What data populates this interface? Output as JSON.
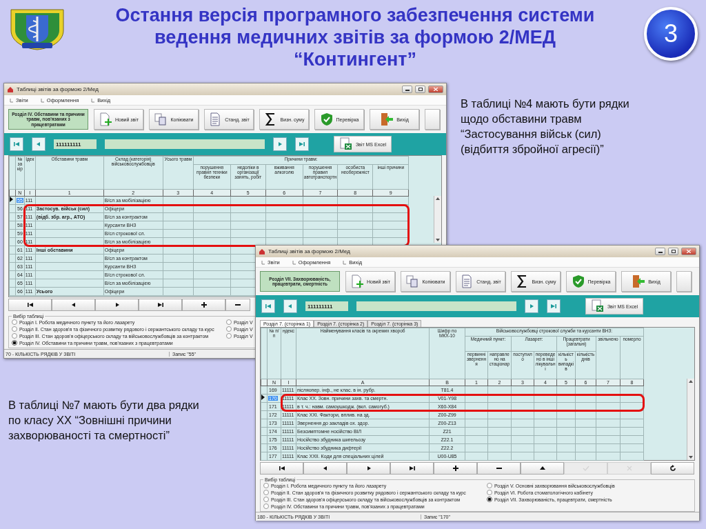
{
  "slide": {
    "title": "Остання версія програмного забезпечення системи ведення медичних звітів за формою 2/МЕД “Контингент”",
    "page_number": "3"
  },
  "notes": [
    {
      "text": "В таблиці №4 мають бути рядки\nщодо обставини травм\n“Застосування військ (сил)\n(відбиття збройної агресії)”"
    },
    {
      "text": "В таблиці №7 мають бути два рядки\nпо класу XX “Зовнішні причини\nзахворюваності та смертності”"
    }
  ],
  "windows": [
    {
      "title": "Таблиці звітів за формою 2/Мед",
      "menu": [
        "Звіти",
        "Оформлення",
        "Вихід"
      ],
      "section": "Розділ IV. Обставини та причини травм, пов'язаних з працевтратами",
      "toolbar": [
        {
          "kind": "new",
          "label": "Новий звіт"
        },
        {
          "kind": "copy",
          "label": "Копіювати"
        },
        {
          "kind": "report",
          "label": "Станд. звіт"
        },
        {
          "kind": "sum",
          "label": "Визн. суму"
        },
        {
          "kind": "check",
          "label": "Перевірка"
        },
        {
          "kind": "exit",
          "label": "Вихід"
        },
        {
          "kind": "blank"
        }
      ],
      "navigator": {
        "buttons": [
          {
            "kind": "first"
          },
          {
            "kind": "prev"
          },
          {
            "kind": "next"
          },
          {
            "kind": "last"
          }
        ],
        "code": "111111111",
        "excel_button": "Звіт MS Excel"
      },
      "table": {
        "kind": "injuries",
        "columns": [
          {
            "label": "№ за кір"
          },
          {
            "label": "Ідек"
          },
          {
            "label": "Обставини травм"
          },
          {
            "label": "Склад (категорія) військовослужбовців"
          },
          {
            "label": "Усього травм"
          },
          {
            "label": "Причини травм:",
            "children": [
              {
                "label": "порушення правил техніки безпеки"
              },
              {
                "label": "недоліки в організації занять, робіт"
              },
              {
                "label": "вживання алкоголю"
              },
              {
                "label": "порушення правил автотранспортн"
              },
              {
                "label": "особиста необережніст"
              },
              {
                "label": "інші причини"
              }
            ]
          }
        ],
        "numbers": [
          "N",
          "I",
          "1",
          "2",
          "3",
          "4",
          "5",
          "6",
          "7",
          "8",
          "9"
        ],
        "rows": [
          {
            "number": "55",
            "index": "111",
            "personnel": "В/сл за мобілізацією",
            "selected": true,
            "highlighted": false
          },
          {
            "number": "56",
            "index": "111",
            "circumstance": "Застосув. військ (сил)",
            "personnel": "Офіцери",
            "selected": false,
            "highlighted": true,
            "heading": true
          },
          {
            "number": "57",
            "index": "111",
            "circumstance": "(відб. збр. агр., АТО)",
            "personnel": "В/сл за контрактом",
            "selected": false,
            "highlighted": true,
            "heading": true
          },
          {
            "number": "58",
            "index": "111",
            "personnel": "Курсанти ВНЗ",
            "selected": false,
            "highlighted": true
          },
          {
            "number": "59",
            "index": "111",
            "personnel": "В/сл строкової сл.",
            "selected": false,
            "highlighted": true
          },
          {
            "number": "60",
            "index": "111",
            "personnel": "В/сл за мобілізацією",
            "selected": false,
            "highlighted": true
          },
          {
            "number": "61",
            "index": "111",
            "circumstance": "Інші обставини",
            "personnel": "Офіцери",
            "selected": false,
            "highlighted": false,
            "heading": true
          },
          {
            "number": "62",
            "index": "111",
            "personnel": "В/сл за контрактом",
            "selected": false,
            "highlighted": false
          },
          {
            "number": "63",
            "index": "111",
            "personnel": "Курсанти ВНЗ",
            "selected": false,
            "highlighted": false
          },
          {
            "number": "64",
            "index": "111",
            "personnel": "В/сл строкової сл.",
            "selected": false,
            "highlighted": false
          },
          {
            "number": "65",
            "index": "111",
            "personnel": "В/сл за мобілізацією",
            "selected": false,
            "highlighted": false
          },
          {
            "number": "66",
            "index": "111",
            "circumstance": "Усього",
            "personnel": "Офіцери",
            "selected": false,
            "highlighted": false,
            "heading": true
          }
        ]
      },
      "nav_buttons": [
        {
          "kind": "first",
          "disabled": false
        },
        {
          "kind": "prev",
          "disabled": false
        },
        {
          "kind": "next",
          "disabled": false
        },
        {
          "kind": "last",
          "disabled": false
        },
        {
          "kind": "add",
          "disabled": false
        },
        {
          "kind": "remove",
          "disabled": false
        }
      ],
      "table_choice": {
        "label": "Вибір таблиці",
        "options": [
          {
            "label": "Розділ I. Робота медичного пункту та його лазарету",
            "selected": false
          },
          {
            "label": "Розділ II. Стан здоров'я та фізичного розвитку рядового і сержантського складу та курс",
            "selected": false
          },
          {
            "label": "Розділ III. Стан здоров'я офіцерського складу та військовослужбовців за контрактом",
            "selected": false
          },
          {
            "label": "Розділ IV. Обставини та причини травм, пов'язаних з працевтратами",
            "selected": true
          },
          {
            "label": "Розділ V",
            "selected": false
          },
          {
            "label": "Розділ V",
            "selected": false
          },
          {
            "label": "Розділ V",
            "selected": false
          }
        ]
      },
      "status": {
        "count": "70 - КІЛЬКІСТЬ РЯДКІВ У ЗВІТІ",
        "record": "Запис \"55\""
      }
    },
    {
      "title": "Таблиці звітів за формою 2/Мед",
      "menu": [
        "Звіти",
        "Оформлення",
        "Вихід"
      ],
      "section": "Розділ VII. Захворюваність, працевтрати, смертність",
      "toolbar": [
        {
          "kind": "new",
          "label": "Новий звіт"
        },
        {
          "kind": "copy",
          "label": "Копіювати"
        },
        {
          "kind": "report",
          "label": "Станд. звіт"
        },
        {
          "kind": "sum",
          "label": "Визн. суму"
        },
        {
          "kind": "check",
          "label": "Перевірка"
        },
        {
          "kind": "exit",
          "label": "Вихід"
        },
        {
          "kind": "blank"
        }
      ],
      "navigator": {
        "buttons": [
          {
            "kind": "first"
          },
          {
            "kind": "prev"
          },
          {
            "kind": "next"
          },
          {
            "kind": "last"
          }
        ],
        "code": "111111111",
        "excel_button": "Звіт MS Excel"
      },
      "tabs": [
        {
          "label": "Розділ 7. (сторінка 1)",
          "selected": true
        },
        {
          "label": "Розділ 7. (сторінка 2)",
          "selected": false
        },
        {
          "label": "Розділ 7. (сторінка 3)",
          "selected": false
        }
      ],
      "table": {
        "kind": "diseases",
        "columns": [
          {
            "label": "№ п/п"
          },
          {
            "label": "ндекс"
          },
          {
            "label": "Найменування класів та окремих хвороб"
          },
          {
            "label": "Шифр по МКХ-10"
          },
          {
            "label": "Військовослужбовці строкової служби та курсанти ВНЗ:",
            "children": [
              {
                "label": "Медичний пункт:",
                "children": [
                  {
                    "label": "первинні звернення"
                  },
                  {
                    "label": "направлено на стаціонар"
                  }
                ]
              },
              {
                "label": "Лазарет:",
                "children": [
                  {
                    "label": "поступило"
                  },
                  {
                    "label": "переведено в інші лікувальні"
                  }
                ]
              },
              {
                "label": "Працевтрати (загальні)",
                "children": [
                  {
                    "label": "кількість випадків"
                  },
                  {
                    "label": "кількість днів"
                  }
                ]
              },
              {
                "label": "звільнено"
              },
              {
                "label": "померло"
              }
            ]
          }
        ],
        "numbers": [
          "N",
          "I",
          "A",
          "B",
          "1",
          "2",
          "3",
          "4",
          "5",
          "6",
          "7",
          "8"
        ],
        "rows": [
          {
            "number": "169",
            "index": "11111",
            "disease": "післяопер. інф., не клас. в ін. рубр.",
            "icd_code": "T81.4",
            "selected": false,
            "highlighted": false
          },
          {
            "number": "170",
            "index": "11111",
            "disease": "Клас XX. Зовн. причини захв. та смертн.",
            "icd_code": "V01-Y98",
            "selected": true,
            "highlighted": true
          },
          {
            "number": "171",
            "index": "11111",
            "disease": "в т. ч.: навм. самоушкодж. (вкл. самогуб.)",
            "icd_code": "X60-X84",
            "selected": false,
            "highlighted": true
          },
          {
            "number": "172",
            "index": "11111",
            "disease": "Клас XXI. Фактори, вплив. на зд.",
            "icd_code": "Z00-Z99",
            "selected": false,
            "highlighted": false
          },
          {
            "number": "173",
            "index": "11111",
            "disease": "Звернення до закладів ох. здор.",
            "icd_code": "Z00-Z13",
            "selected": false,
            "highlighted": false
          },
          {
            "number": "174",
            "index": "11111",
            "disease": "Безсимптомне носійство ВІЛ",
            "icd_code": "Z21",
            "selected": false,
            "highlighted": false
          },
          {
            "number": "175",
            "index": "11111",
            "disease": "Носійство збудника шигельозу",
            "icd_code": "Z22.1",
            "selected": false,
            "highlighted": false
          },
          {
            "number": "176",
            "index": "11111",
            "disease": "Носійство збудника дифтерії",
            "icd_code": "Z22.2",
            "selected": false,
            "highlighted": false
          },
          {
            "number": "177",
            "index": "11111",
            "disease": "Клас XXII. Коди для спеціальних цілей",
            "icd_code": "U00-U85",
            "selected": false,
            "highlighted": false
          }
        ]
      },
      "nav_buttons": [
        {
          "kind": "first",
          "disabled": false
        },
        {
          "kind": "prev",
          "disabled": false
        },
        {
          "kind": "next",
          "disabled": false
        },
        {
          "kind": "last",
          "disabled": false
        },
        {
          "kind": "add",
          "disabled": false
        },
        {
          "kind": "remove",
          "disabled": false
        },
        {
          "kind": "up",
          "disabled": false
        },
        {
          "kind": "confirm",
          "disabled": true
        },
        {
          "kind": "cancel",
          "disabled": true
        },
        {
          "kind": "refresh",
          "disabled": false
        }
      ],
      "table_choice": {
        "label": "Вибір таблиці",
        "options": [
          {
            "label": "Розділ I. Робота медичного пункту та його лазарету",
            "selected": false
          },
          {
            "label": "Розділ II. Стан здоров'я та фізичного розвитку рядового і сержантського складу та курс",
            "selected": false
          },
          {
            "label": "Розділ III. Стан здоров'я офіцерського складу та військовослужбовців за контрактом",
            "selected": false
          },
          {
            "label": "Розділ IV. Обставини та причини травм, пов'язаних з працевтратами",
            "selected": false
          },
          {
            "label": "Розділ V. Основні захворювання військовослужбовців",
            "selected": false
          },
          {
            "label": "Розділ VI. Робота стоматологічного кабінету",
            "selected": false
          },
          {
            "label": "Розділ VII. Захворюваність, працевтрати, смертність",
            "selected": true
          }
        ]
      },
      "status": {
        "count": "180 - КІЛЬКІСТЬ РЯДКІВ У ЗВІТІ",
        "record": "Запис \"170\""
      }
    }
  ]
}
